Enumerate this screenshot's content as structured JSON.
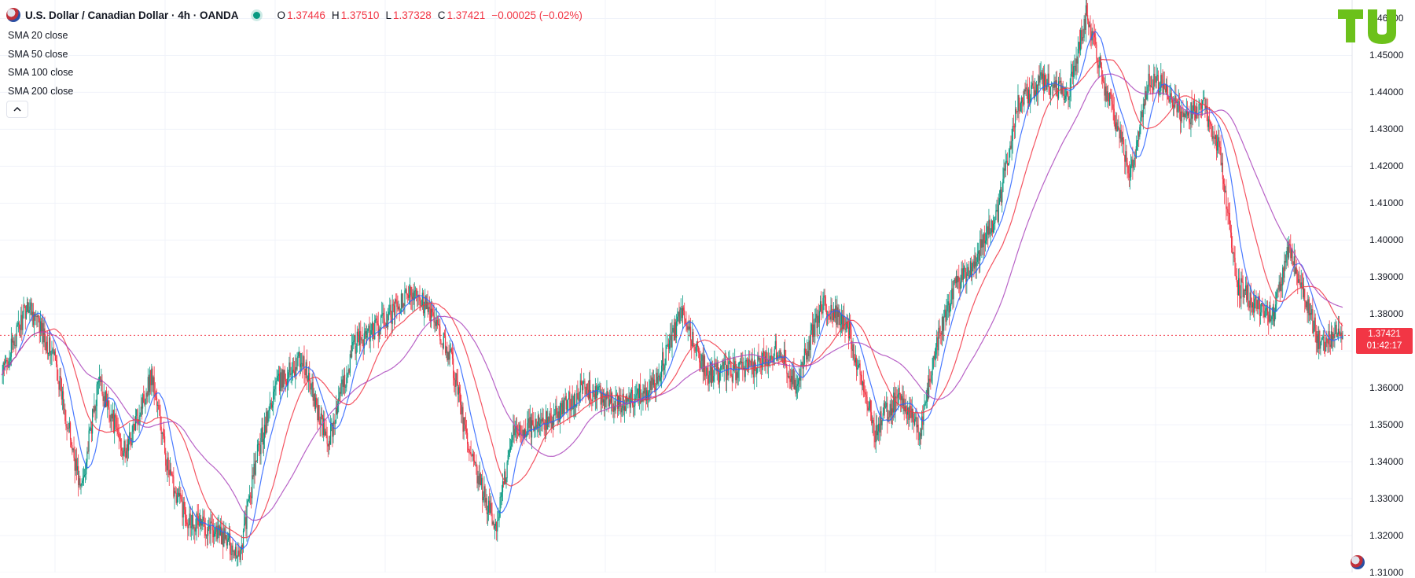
{
  "header": {
    "title": "U.S. Dollar / Canadian Dollar · 4h · OANDA",
    "open_key": "O",
    "open": "1.37446",
    "high_key": "H",
    "high": "1.37510",
    "low_key": "L",
    "low": "1.37328",
    "close_key": "C",
    "close": "1.37421",
    "change": "−0.00025 (−0.02%)"
  },
  "indicators": [
    "SMA 20 close",
    "SMA 50 close",
    "SMA 100 close",
    "SMA 200 close"
  ],
  "last_price": {
    "value": "1.37421",
    "countdown": "01:42:17",
    "price": 1.37421
  },
  "colors": {
    "up": "#089981",
    "down": "#f23645",
    "sma20": "#2962ff",
    "sma50": "#f23645",
    "sma200": "#ab47bc",
    "grid": "#f0f3fa",
    "logo": "#6cc11b"
  },
  "icons": {
    "collapse": "chevron-up-icon",
    "live": "live-dot-icon",
    "flag": "us-ca-flag-icon",
    "logo": "logo-icon"
  },
  "chart_data": {
    "type": "line",
    "title": "U.S. Dollar / Canadian Dollar · 4h · OANDA",
    "ylim": [
      1.31,
      1.465
    ],
    "y_ticks": [
      "1.46000",
      "1.45000",
      "1.44000",
      "1.43000",
      "1.42000",
      "1.41000",
      "1.40000",
      "1.39000",
      "1.38000",
      "1.37000",
      "1.36000",
      "1.35000",
      "1.34000",
      "1.33000",
      "1.32000",
      "1.31000"
    ],
    "grid": true,
    "x_index": [
      0,
      30,
      60,
      90,
      110,
      140,
      170,
      190,
      210,
      240,
      270,
      290,
      310,
      340,
      370,
      400,
      430,
      470,
      510,
      530,
      560,
      580,
      620,
      660,
      700,
      740,
      770,
      800,
      850,
      880,
      900,
      930,
      960,
      990,
      1000,
      1020,
      1040,
      1060,
      1080,
      1100,
      1115,
      1130,
      1150,
      1180,
      1210,
      1230,
      1250,
      1280,
      1300,
      1320,
      1340,
      1360,
      1380,
      1400,
      1420,
      1440,
      1460,
      1480,
      1495,
      1505,
      1512,
      1520
    ],
    "series": [
      {
        "name": "close",
        "values": [
          1.363,
          1.383,
          1.368,
          1.332,
          1.362,
          1.342,
          1.364,
          1.336,
          1.325,
          1.322,
          1.315,
          1.342,
          1.36,
          1.368,
          1.345,
          1.372,
          1.377,
          1.387,
          1.368,
          1.342,
          1.322,
          1.348,
          1.351,
          1.36,
          1.355,
          1.361,
          1.38,
          1.364,
          1.365,
          1.371,
          1.361,
          1.383,
          1.376,
          1.348,
          1.353,
          1.358,
          1.347,
          1.372,
          1.388,
          1.393,
          1.401,
          1.408,
          1.436,
          1.443,
          1.44,
          1.462,
          1.442,
          1.418,
          1.444,
          1.441,
          1.432,
          1.438,
          1.425,
          1.388,
          1.383,
          1.379,
          1.398,
          1.382,
          1.371,
          1.374,
          1.3745,
          1.37421
        ]
      }
    ]
  }
}
